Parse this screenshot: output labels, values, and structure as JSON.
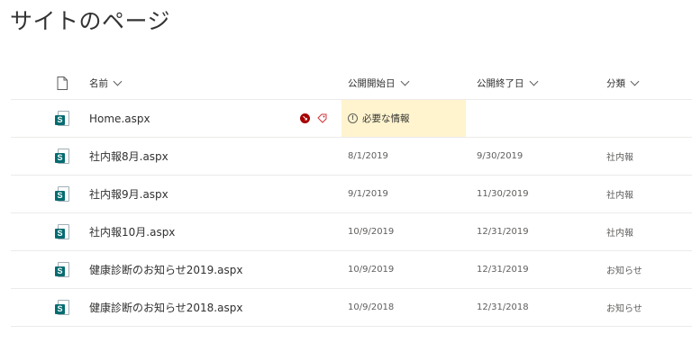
{
  "page": {
    "title": "サイトのページ"
  },
  "columns": {
    "name": "名前",
    "pub_start": "公開開始日",
    "pub_end": "公開終了日",
    "category": "分類"
  },
  "home_row": {
    "name": "Home.aspx",
    "required_text": "必要な情報"
  },
  "rows": [
    {
      "name": "社内報8月.aspx",
      "pub_start": "8/1/2019",
      "pub_end": "9/30/2019",
      "category": "社内報"
    },
    {
      "name": "社内報9月.aspx",
      "pub_start": "9/1/2019",
      "pub_end": "11/30/2019",
      "category": "社内報"
    },
    {
      "name": "社内報10月.aspx",
      "pub_start": "10/9/2019",
      "pub_end": "12/31/2019",
      "category": "社内報"
    },
    {
      "name": "健康診断のお知らせ2019.aspx",
      "pub_start": "10/9/2019",
      "pub_end": "12/31/2019",
      "category": "お知らせ"
    },
    {
      "name": "健康診断のお知らせ2018.aspx",
      "pub_start": "10/9/2018",
      "pub_end": "12/31/2018",
      "category": "お知らせ"
    }
  ],
  "colors": {
    "sharepoint_teal": "#036c70",
    "required_bg": "#fff4ce",
    "alert_red": "#a80000"
  }
}
